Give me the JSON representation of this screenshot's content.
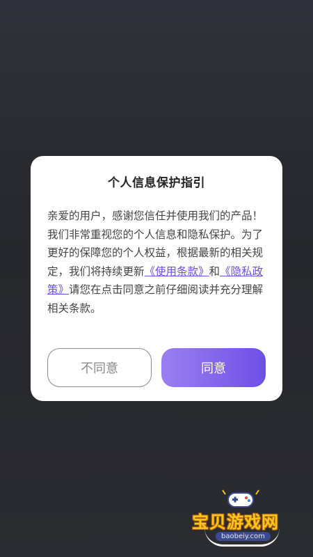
{
  "dialog": {
    "title": "个人信息保护指引",
    "body_before": "亲爱的用户，感谢您信任并使用我们的产品！我们非常重视您的个人信息和隐私保护。为了更好的保障您的个人权益，根据最新的相关规定，我们将持续更新",
    "terms_link": "《使用条款》",
    "connector": "和",
    "privacy_link": "《隐私政策》",
    "body_after": "请您在点击同意之前仔细阅读并充分理解相关条款。",
    "disagree_label": "不同意",
    "agree_label": "同意"
  },
  "watermark": {
    "name": "宝贝游戏网",
    "url": "baobeiy.com"
  },
  "colors": {
    "accent_start": "#9b7ff0",
    "accent_end": "#6e50e6",
    "link": "#6b4de6",
    "background": "#2a2b30"
  }
}
